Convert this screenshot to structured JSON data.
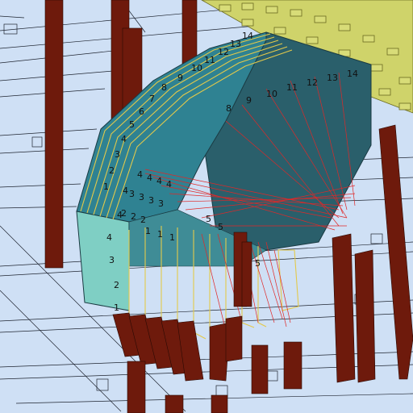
{
  "scene": {
    "colors": {
      "background": "#cfe0f5",
      "grid": "#1e2430",
      "column": "#6e1a0c",
      "column_highlight": "#9a3a22",
      "box_top": "#2f8292",
      "box_side": "#2a5f6b",
      "box_front": "#7fcfc4",
      "slice_outline": "#e3c94a",
      "cable": "#e02828",
      "roof_truss": "#cfd36a"
    },
    "front_stack_labels": [
      "1",
      "2",
      "3",
      "4",
      "4",
      "4"
    ],
    "top_row_labels": [
      "14",
      "13",
      "12",
      "11",
      "10",
      "9",
      "8",
      "7",
      "6",
      "5",
      "4",
      "3",
      "2",
      "1"
    ],
    "right_edge_labels": [
      "14",
      "13",
      "12",
      "11",
      "10",
      "9",
      "8"
    ],
    "inner_labels": [
      "4",
      "4",
      "4",
      "4",
      "3",
      "3",
      "3",
      "3",
      "2",
      "2",
      "2",
      "1",
      "1",
      "1",
      "5",
      "5",
      "5"
    ]
  }
}
